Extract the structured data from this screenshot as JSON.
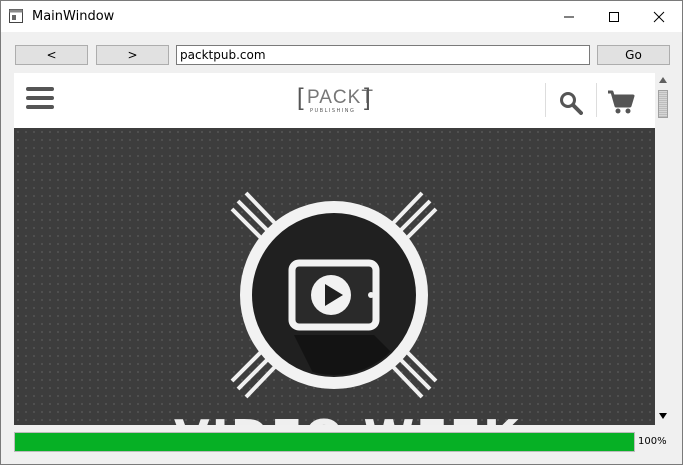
{
  "window": {
    "title": "MainWindow"
  },
  "toolbar": {
    "back_label": "<",
    "forward_label": ">",
    "url": "packtpub.com",
    "go_label": "Go"
  },
  "site": {
    "logo_text": "PACKT",
    "logo_subtext": "PUBLISHING",
    "hero_heading": "VIDEO WEEK"
  },
  "progress": {
    "value": 100,
    "label": "100%"
  },
  "colors": {
    "progress_fill": "#06b025",
    "hero_bg": "#3d3d3d",
    "icon_gray": "#555555"
  }
}
